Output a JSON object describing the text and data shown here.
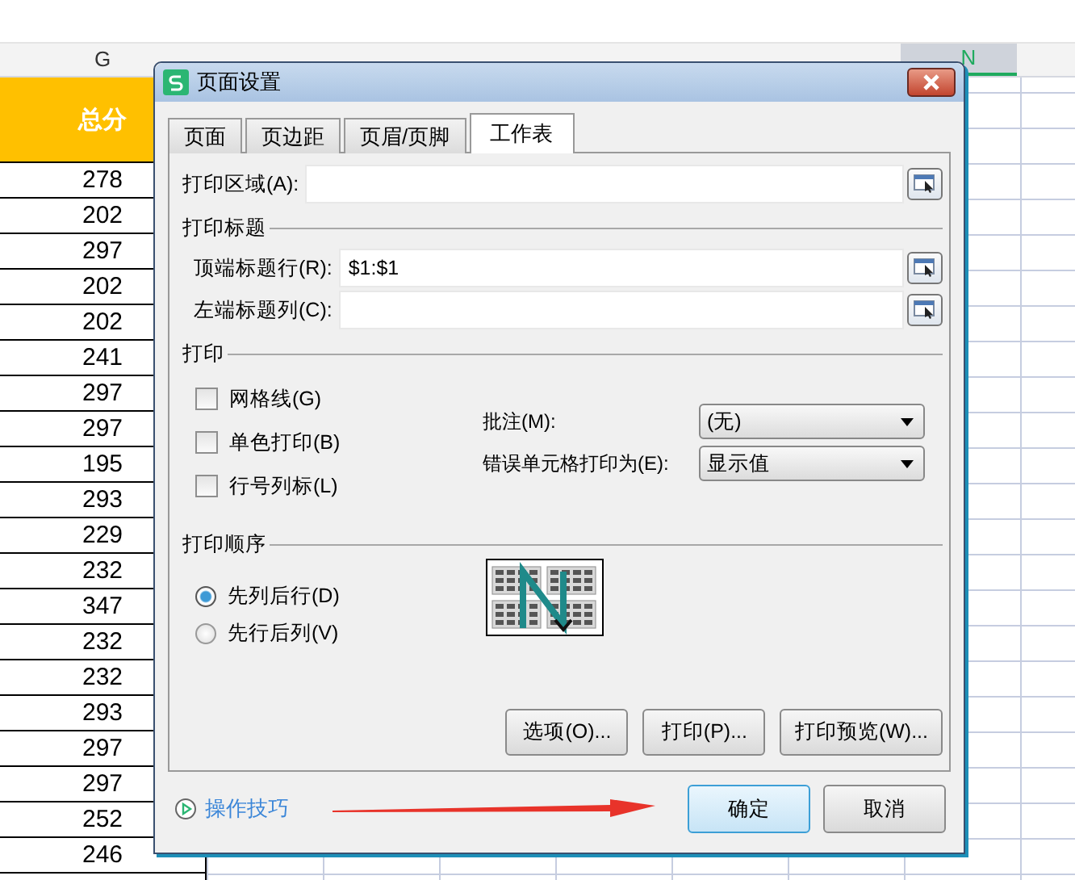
{
  "sheet": {
    "columns": [
      {
        "label": "G",
        "selected": false
      },
      {
        "label": "N",
        "selected": true
      }
    ],
    "header_cell": "总分",
    "values": [
      "278",
      "202",
      "297",
      "202",
      "202",
      "241",
      "297",
      "297",
      "195",
      "293",
      "229",
      "232",
      "347",
      "232",
      "232",
      "293",
      "297",
      "297",
      "252",
      "246"
    ]
  },
  "dialog": {
    "title": "页面设置",
    "tabs": [
      {
        "label": "页面",
        "selected": false
      },
      {
        "label": "页边距",
        "selected": false
      },
      {
        "label": "页眉/页脚",
        "selected": false
      },
      {
        "label": "工作表",
        "selected": true
      }
    ],
    "print_area": {
      "label": "打印区域(A):"
    },
    "print_titles": {
      "heading": "打印标题",
      "fields": [
        {
          "label": "顶端标题行(R):",
          "value": "$1:$1"
        },
        {
          "label": "左端标题列(C):"
        }
      ]
    },
    "print": {
      "heading": "打印",
      "checkboxes": [
        {
          "label": "网格线(G)",
          "checked": false
        },
        {
          "label": "单色打印(B)",
          "checked": false
        },
        {
          "label": "行号列标(L)",
          "checked": false
        }
      ],
      "dropdowns": [
        {
          "label": "批注(M):",
          "value": "(无)"
        },
        {
          "label": "错误单元格打印为(E):",
          "value": "显示值"
        }
      ]
    },
    "print_order": {
      "heading": "打印顺序",
      "options": [
        {
          "label": "先列后行(D)",
          "selected": true
        },
        {
          "label": "先行后列(V)",
          "selected": false
        }
      ]
    },
    "buttons": [
      "选项(O)...",
      "打印(P)...",
      "打印预览(W)..."
    ],
    "tips_link": "操作技巧",
    "ok": "确定",
    "cancel": "取消"
  }
}
